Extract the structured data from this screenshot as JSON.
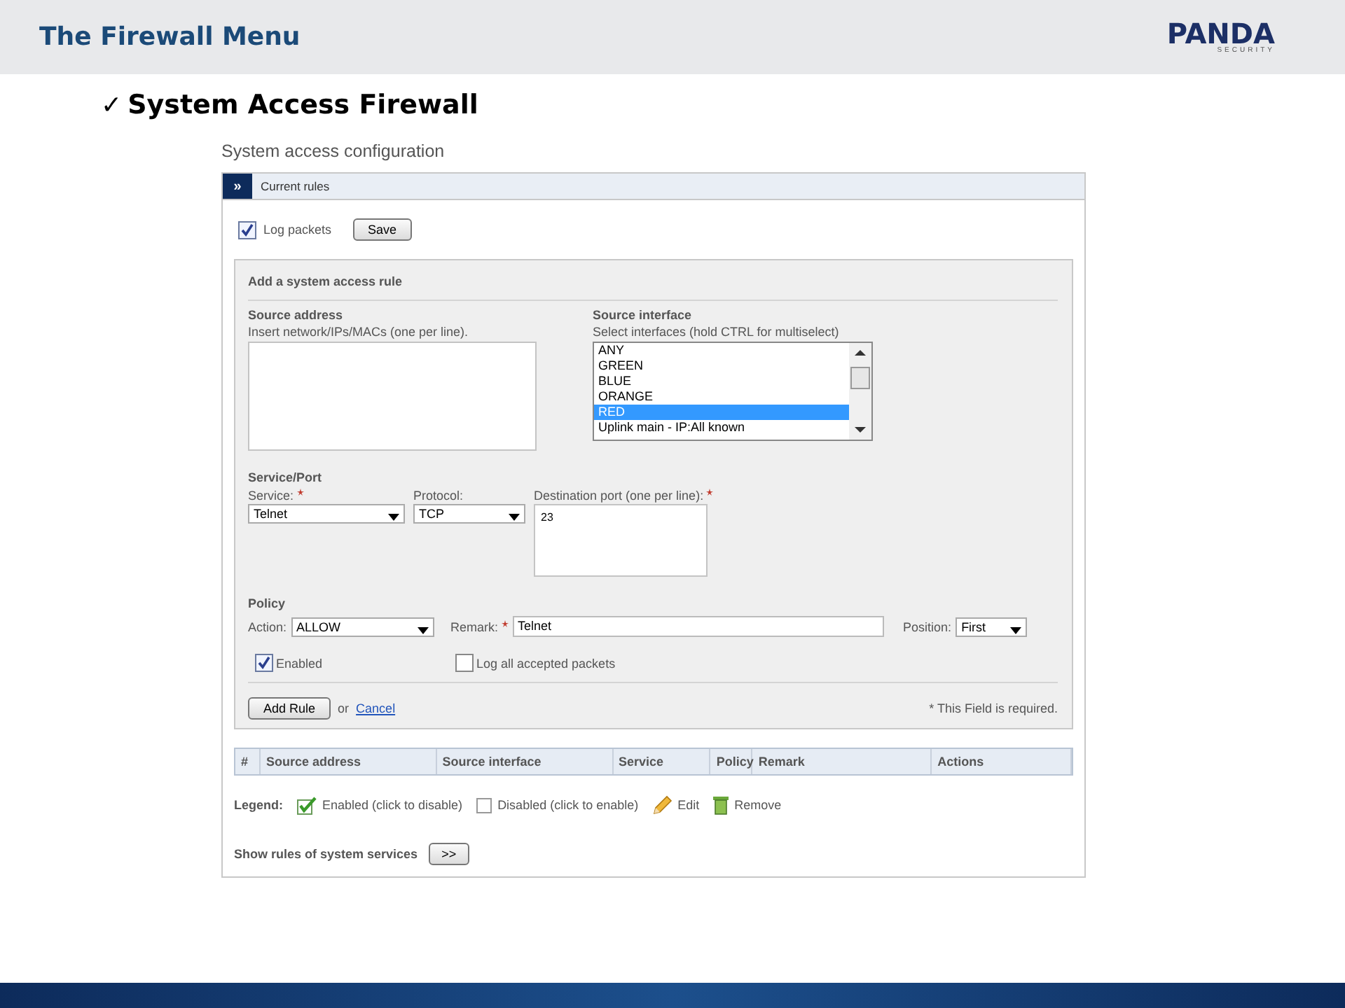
{
  "slide": {
    "title": "The Firewall Menu",
    "logo": {
      "name": "PANDA",
      "tagline": "SECURITY"
    },
    "bullet": {
      "mark": "✓",
      "text": "System Access Firewall"
    }
  },
  "page_title": "System access configuration",
  "panel": {
    "toggle": "»",
    "title": "Current rules"
  },
  "log_packets": {
    "label": "Log packets",
    "checked": true
  },
  "save_button": "Save",
  "form": {
    "title": "Add a system access rule",
    "source_address": {
      "heading": "Source address",
      "hint": "Insert network/IPs/MACs (one per line)."
    },
    "source_interface": {
      "heading": "Source interface",
      "hint": "Select interfaces (hold CTRL for multiselect)",
      "options": [
        {
          "label": "ANY",
          "selected": false
        },
        {
          "label": "GREEN",
          "selected": false
        },
        {
          "label": "BLUE",
          "selected": false
        },
        {
          "label": "ORANGE",
          "selected": false
        },
        {
          "label": "RED",
          "selected": true
        },
        {
          "label": "Uplink main - IP:All known",
          "selected": false
        }
      ]
    },
    "service_port": {
      "heading": "Service/Port",
      "service": {
        "label": "Service:",
        "required": true,
        "value": "Telnet"
      },
      "protocol": {
        "label": "Protocol:",
        "required": false,
        "value": "TCP"
      },
      "destination_port": {
        "label": "Destination port (one per line):",
        "required": true,
        "value": "23"
      }
    },
    "policy": {
      "heading": "Policy",
      "action": {
        "label": "Action:",
        "required": false,
        "value": "ALLOW"
      },
      "remark": {
        "label": "Remark:",
        "required": true,
        "value": "Telnet"
      },
      "position": {
        "label": "Position:",
        "required": false,
        "value": "First"
      },
      "enabled": {
        "label": "Enabled",
        "checked": true
      },
      "log_accepted": {
        "label": "Log all accepted packets",
        "checked": false
      }
    },
    "add_button": "Add Rule",
    "or_text": "or",
    "cancel_link": "Cancel",
    "required_note": "* This Field is required."
  },
  "table": {
    "columns": [
      "#",
      "Source address",
      "Source interface",
      "Service",
      "Policy",
      "Remark",
      "Actions"
    ]
  },
  "legend": {
    "label": "Legend:",
    "items": [
      {
        "kind": "enabled",
        "label": "Enabled (click to disable)"
      },
      {
        "kind": "disabled",
        "label": "Disabled (click to enable)"
      },
      {
        "kind": "edit",
        "label": "Edit"
      },
      {
        "kind": "remove",
        "label": "Remove"
      }
    ]
  },
  "system_services": {
    "label": "Show rules of system services",
    "button": ">>"
  }
}
